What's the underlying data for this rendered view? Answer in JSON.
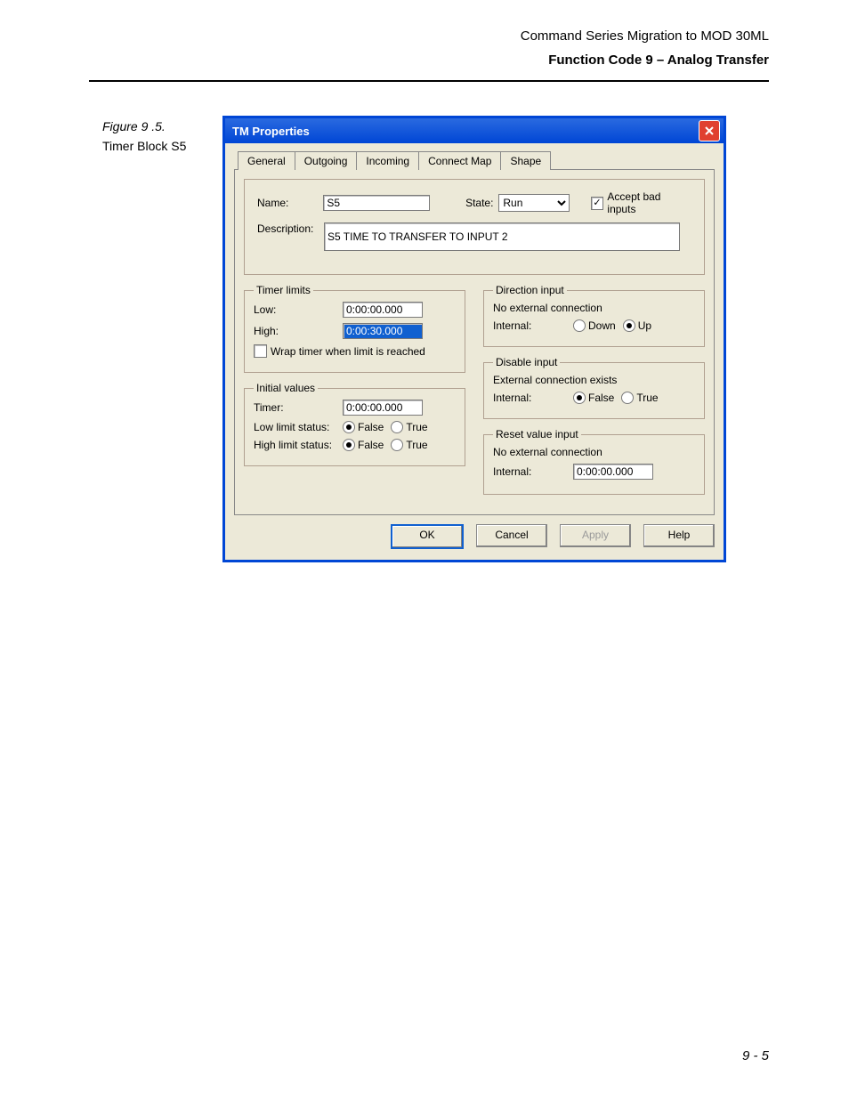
{
  "header": {
    "line1": "Command Series Migration to MOD 30ML",
    "line2": "Function Code 9 – Analog Transfer"
  },
  "figure": {
    "num": "Figure 9 .5.",
    "caption": "Timer Block S5"
  },
  "dialog": {
    "title": "TM Properties",
    "tabs": [
      "General",
      "Outgoing",
      "Incoming",
      "Connect Map",
      "Shape"
    ],
    "general": {
      "name_label": "Name:",
      "name_value": "S5",
      "state_label": "State:",
      "state_value": "Run",
      "accept_label": "Accept bad inputs",
      "accept_checked": "✓",
      "desc_label": "Description:",
      "desc_value": "S5 TIME TO TRANSFER TO INPUT 2",
      "timer_limits": {
        "legend": "Timer limits",
        "low_label": "Low:",
        "low_value": "0:00:00.000",
        "high_label": "High:",
        "high_value": "0:00:30.000",
        "wrap_label": "Wrap timer when limit is reached"
      },
      "initial": {
        "legend": "Initial values",
        "timer_label": "Timer:",
        "timer_value": "0:00:00.000",
        "lowstat_label": "Low limit status:",
        "highstat_label": "High limit status:",
        "false_label": "False",
        "true_label": "True"
      },
      "direction": {
        "legend": "Direction input",
        "note": "No external connection",
        "internal_label": "Internal:",
        "down_label": "Down",
        "up_label": "Up"
      },
      "disable": {
        "legend": "Disable input",
        "note": "External connection exists",
        "internal_label": "Internal:",
        "false_label": "False",
        "true_label": "True"
      },
      "reset": {
        "legend": "Reset value input",
        "note": "No external connection",
        "internal_label": "Internal:",
        "value": "0:00:00.000"
      }
    },
    "buttons": {
      "ok": "OK",
      "cancel": "Cancel",
      "apply": "Apply",
      "help": "Help"
    }
  },
  "page_number": "9 - 5"
}
